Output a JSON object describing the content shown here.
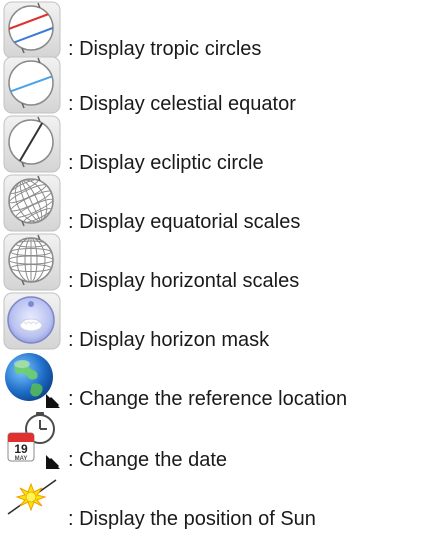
{
  "legend": {
    "items": [
      {
        "icon": "tropic-circles-icon",
        "text": ": Display tropic circles"
      },
      {
        "icon": "celestial-equator-icon",
        "text": ": Display celestial equator"
      },
      {
        "icon": "ecliptic-circle-icon",
        "text": ": Display ecliptic circle"
      },
      {
        "icon": "equatorial-scales-icon",
        "text": ": Display equatorial scales"
      },
      {
        "icon": "horizontal-scales-icon",
        "text": ": Display horizontal scales"
      },
      {
        "icon": "horizon-mask-icon",
        "text": ": Display horizon mask"
      },
      {
        "icon": "earth-location-icon",
        "text": ": Change the reference location"
      },
      {
        "icon": "calendar-date-icon",
        "text": ": Change the date",
        "calendar_day": "19",
        "calendar_month": "MAY"
      },
      {
        "icon": "sun-position-icon",
        "text": ": Display the position of Sun"
      }
    ]
  }
}
